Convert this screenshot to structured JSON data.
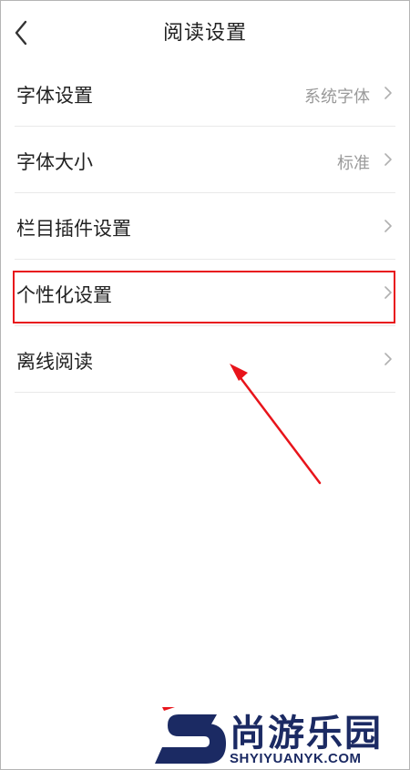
{
  "header": {
    "title": "阅读设置",
    "back_icon": "chevron-left-icon"
  },
  "settings": [
    {
      "label": "字体设置",
      "value": "系统字体"
    },
    {
      "label": "字体大小",
      "value": "标准"
    },
    {
      "label": "栏目插件设置",
      "value": ""
    },
    {
      "label": "个性化设置",
      "value": ""
    },
    {
      "label": "离线阅读",
      "value": ""
    }
  ],
  "annotation": {
    "highlight_color": "#e8141b",
    "highlighted_item": "个性化设置"
  },
  "watermark": {
    "brand": "尚游乐园",
    "domain": "SHYIYUANYK.COM",
    "colors": {
      "primary": "#1b2a63",
      "accent": "#e8141b"
    }
  }
}
